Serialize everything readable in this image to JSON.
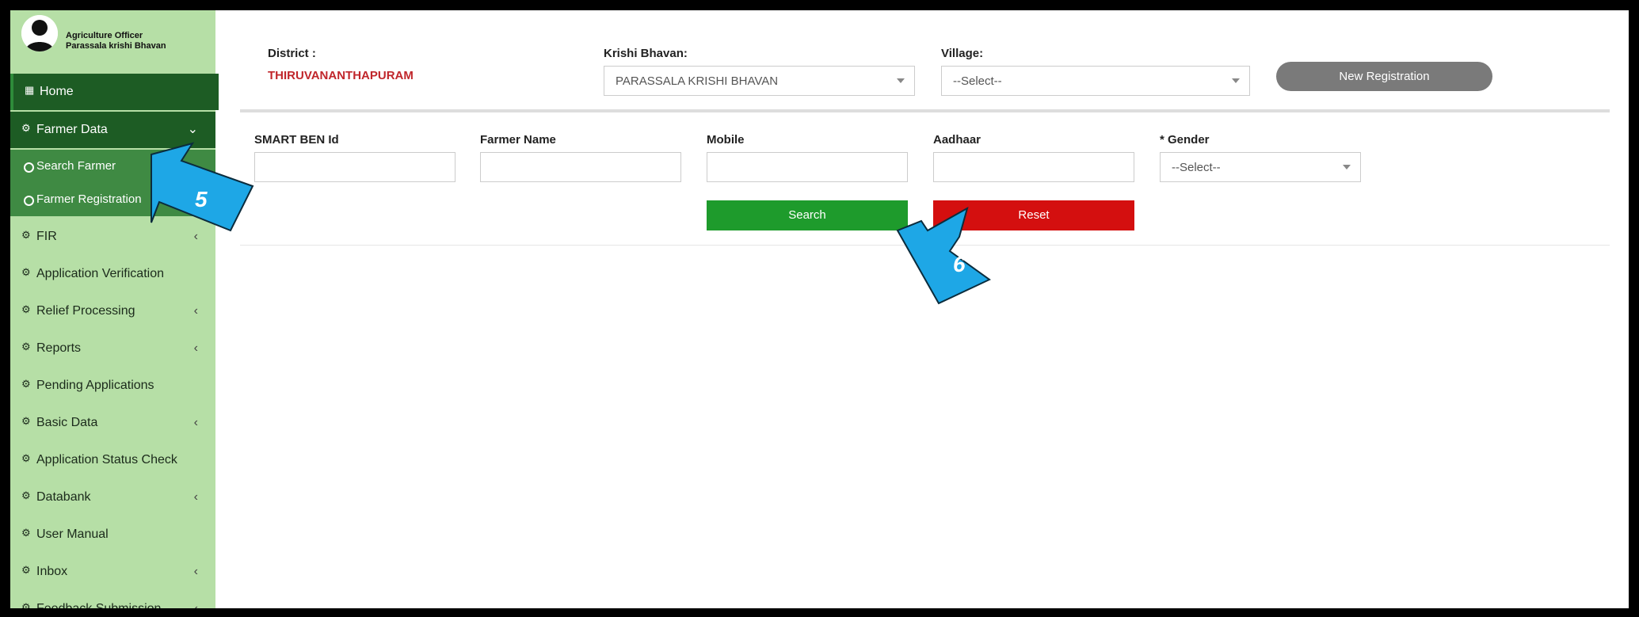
{
  "user": {
    "role": "Agriculture Officer",
    "office": "Parassala krishi Bhavan"
  },
  "sidebar": {
    "items": [
      {
        "label": "Home",
        "icon": "grid-icon"
      },
      {
        "label": "Farmer Data",
        "icon": "dashboard-icon"
      },
      {
        "label": "Search Farmer",
        "icon": "circle-icon"
      },
      {
        "label": "Farmer Registration",
        "icon": "circle-icon"
      },
      {
        "label": "FIR",
        "icon": "dashboard-icon"
      },
      {
        "label": "Application Verification",
        "icon": "dashboard-icon"
      },
      {
        "label": "Relief Processing",
        "icon": "dashboard-icon"
      },
      {
        "label": "Reports",
        "icon": "dashboard-icon"
      },
      {
        "label": "Pending Applications",
        "icon": "dashboard-icon"
      },
      {
        "label": "Basic Data",
        "icon": "dashboard-icon"
      },
      {
        "label": "Application Status Check",
        "icon": "dashboard-icon"
      },
      {
        "label": "Databank",
        "icon": "dashboard-icon"
      },
      {
        "label": "User Manual",
        "icon": "dashboard-icon"
      },
      {
        "label": "Inbox",
        "icon": "dashboard-icon"
      },
      {
        "label": "Feedback Submission",
        "icon": "dashboard-icon"
      }
    ]
  },
  "header": {
    "district_label": "District :",
    "district_value": "THIRUVANANTHAPURAM",
    "krishi_label": "Krishi Bhavan:",
    "krishi_value": "PARASSALA KRISHI BHAVAN",
    "village_label": "Village:",
    "village_value": "--Select--",
    "new_registration": "New Registration"
  },
  "search": {
    "smart_ben_label": "SMART BEN Id",
    "farmer_name_label": "Farmer Name",
    "mobile_label": "Mobile",
    "aadhaar_label": "Aadhaar",
    "gender_label": "* Gender",
    "gender_value": "--Select--",
    "search_button": "Search",
    "reset_button": "Reset"
  },
  "callouts": {
    "step5": "5",
    "step6": "6"
  },
  "colors": {
    "sidebar_bg": "#b6dfa6",
    "sidebar_active": "#1d5c24",
    "submenu": "#3f8a43",
    "district_text": "#c0262b",
    "search_btn": "#1e9b2c",
    "reset_btn": "#d40f0f",
    "callout": "#1ea7e6"
  }
}
